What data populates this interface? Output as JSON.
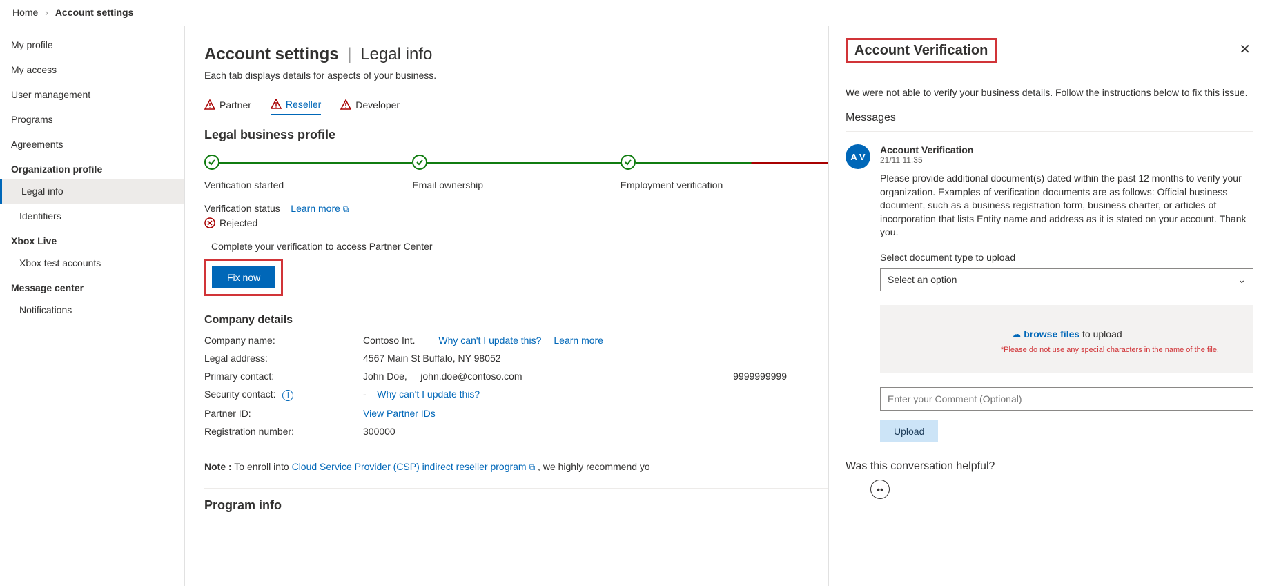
{
  "breadcrumb": {
    "home": "Home",
    "current": "Account settings"
  },
  "sidebar": {
    "items": [
      "My profile",
      "My access",
      "User management",
      "Programs",
      "Agreements"
    ],
    "org_head": "Organization profile",
    "org_items": [
      "Legal info",
      "Identifiers"
    ],
    "xbox_head": "Xbox Live",
    "xbox_items": [
      "Xbox test accounts"
    ],
    "msg_head": "Message center",
    "msg_items": [
      "Notifications"
    ]
  },
  "main": {
    "title_a": "Account settings",
    "title_b": "Legal info",
    "subtitle": "Each tab displays details for aspects of your business.",
    "tabs": [
      "Partner",
      "Reseller",
      "Developer"
    ],
    "legal_h": "Legal business profile",
    "steps": [
      "Verification started",
      "Email ownership",
      "Employment verification"
    ],
    "status_label": "Verification status",
    "learn_more": "Learn more",
    "rejected": "Rejected",
    "cta_msg": "Complete your verification to access Partner Center",
    "fix_now": "Fix now",
    "company_h": "Company details",
    "company": {
      "name_label": "Company name:",
      "name_value": "Contoso Int.",
      "name_link1": "Why can't I update this?",
      "name_link2": "Learn more",
      "addr_label": "Legal address:",
      "addr_value": "4567 Main St Buffalo, NY 98052",
      "primary_label": "Primary contact:",
      "primary_name": "John Doe,",
      "primary_email": "john.doe@contoso.com",
      "primary_phone": "9999999999",
      "sec_label": "Security contact:",
      "sec_dash": "-",
      "sec_link": "Why can't I update this?",
      "pid_label": "Partner ID:",
      "pid_link": "View Partner IDs",
      "reg_label": "Registration number:",
      "reg_value": "300000"
    },
    "note_prefix": "Note :",
    "note_text1": " To enroll into ",
    "note_link": "Cloud Service Provider (CSP) indirect reseller program",
    "note_text2": " , we highly recommend yo",
    "program_h": "Program info"
  },
  "panel": {
    "title": "Account Verification",
    "intro": "We were not able to verify your business details. Follow the instructions below to fix this issue.",
    "messages_h": "Messages",
    "avatar": "A V",
    "sender": "Account Verification",
    "time": "21/11 11:35",
    "body": "Please provide additional document(s) dated within the past 12 months to verify your organization. Examples of verification documents are as follows: Official business document, such as a business registration form, business charter, or articles of incorporation that lists Entity name and address as it is stated on your account. Thank you.",
    "select_label": "Select document type to upload",
    "select_placeholder": "Select an option",
    "browse": "browse files",
    "to_upload": " to upload",
    "warn": "*Please do not use any special characters in the name of the file.",
    "comment_ph": "Enter your Comment (Optional)",
    "upload_btn": "Upload",
    "feedback_q": "Was this conversation helpful?"
  }
}
